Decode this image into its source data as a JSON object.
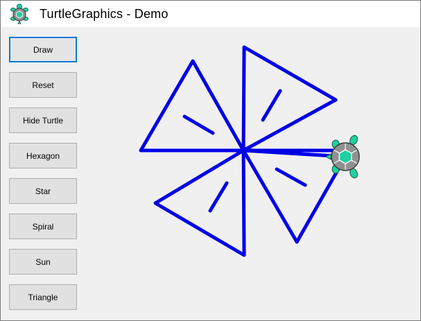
{
  "window": {
    "title": "TurtleGraphics - Demo",
    "app_icon": "turtle-icon"
  },
  "buttons": [
    {
      "label": "Draw",
      "name": "draw-button",
      "is_default": true
    },
    {
      "label": "Reset",
      "name": "reset-button",
      "is_default": false
    },
    {
      "label": "Hide Turtle",
      "name": "hide-turtle-button",
      "is_default": false
    },
    {
      "label": "Hexagon",
      "name": "hexagon-button",
      "is_default": false
    },
    {
      "label": "Star",
      "name": "star-button",
      "is_default": false
    },
    {
      "label": "Spiral",
      "name": "spiral-button",
      "is_default": false
    },
    {
      "label": "Sun",
      "name": "sun-button",
      "is_default": false
    },
    {
      "label": "Triangle",
      "name": "triangle-button",
      "is_default": false
    }
  ],
  "drawing": {
    "pen_color": "#0000e6",
    "turtle_shell_color": "#909090",
    "turtle_body_color": "#20d0a0",
    "turtle_visible": true
  }
}
